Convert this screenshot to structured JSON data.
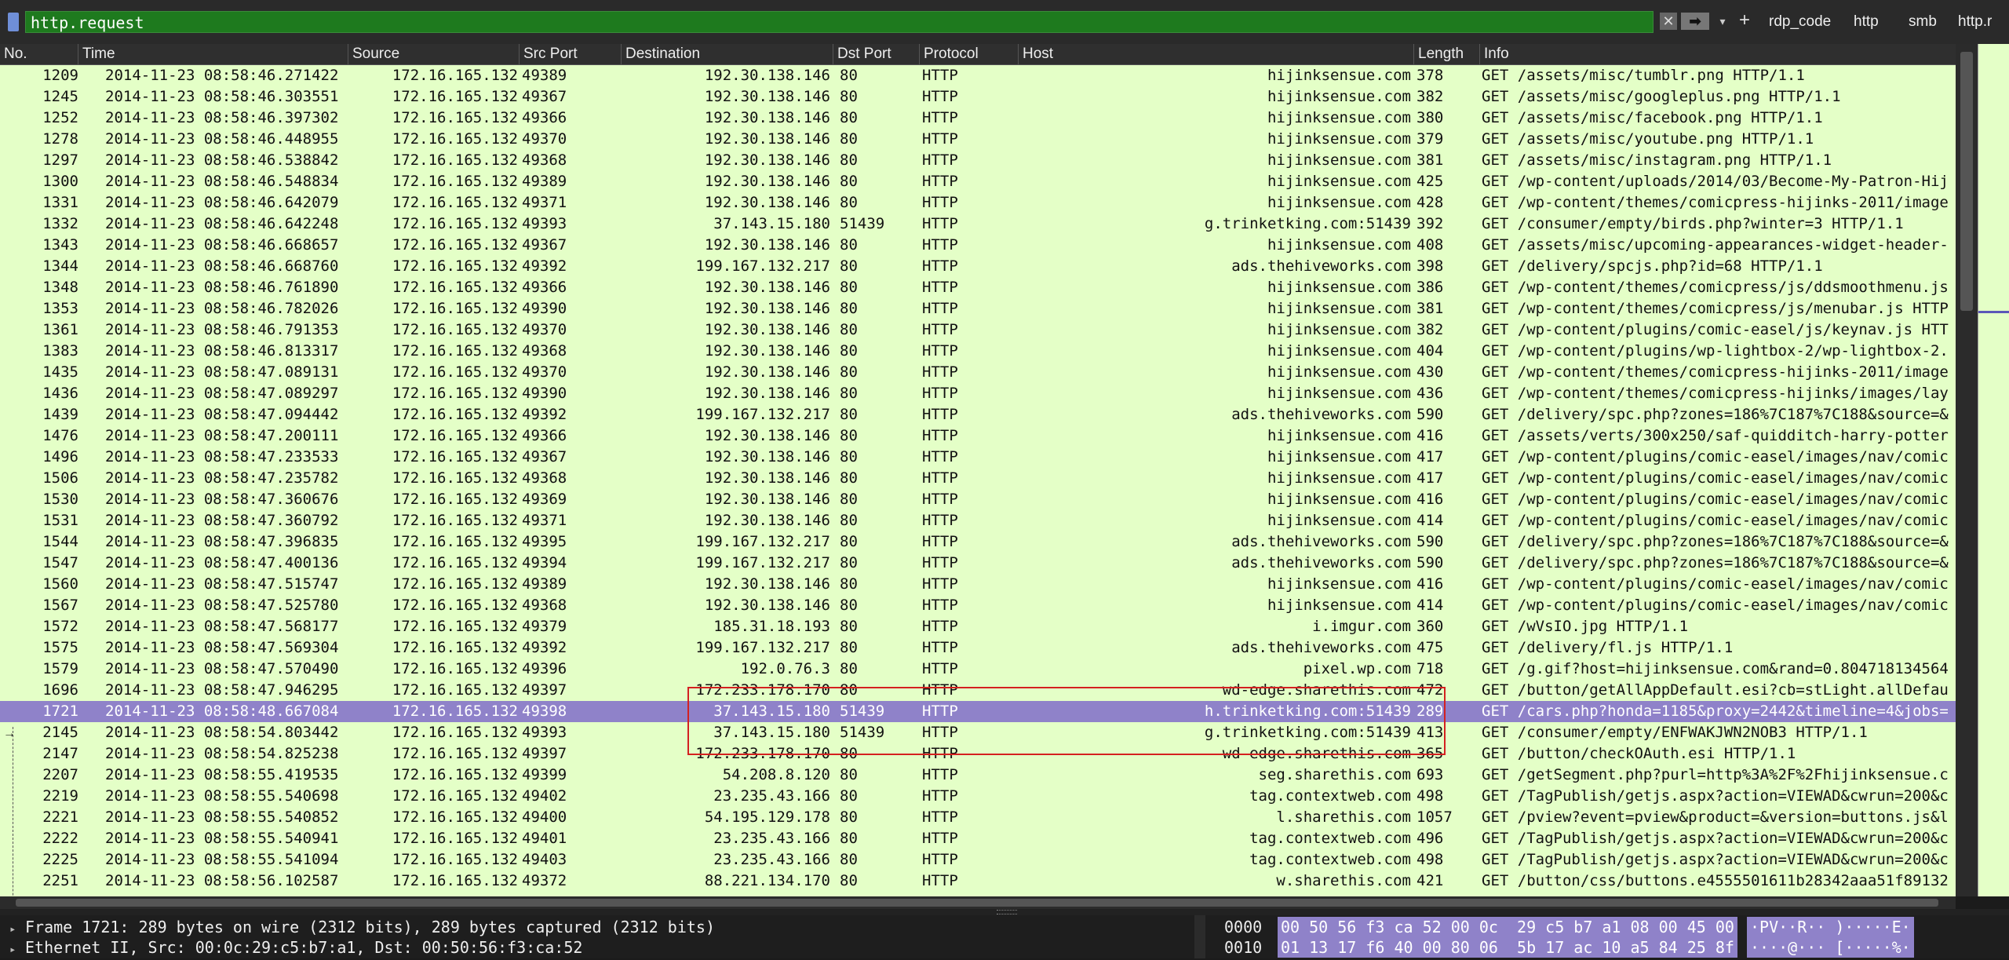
{
  "filter": {
    "value": "http.request",
    "clear_icon": "✕",
    "apply_icon": "➡",
    "dropdown_icon": "▾",
    "add_icon": "+",
    "quick_buttons": [
      "rdp_code",
      "http",
      "smb",
      "http.r"
    ]
  },
  "columns": [
    "No.",
    "Time",
    "Source",
    "Src Port",
    "Destination",
    "Dst Port",
    "Protocol",
    "Host",
    "Length",
    "Info"
  ],
  "selected_frame": "1721",
  "rows": [
    {
      "no": "1209",
      "time": "2014-11-23 08:58:46.271422",
      "src": "172.16.165.132",
      "sport": "49389",
      "dst": "192.30.138.146",
      "dport": "80",
      "proto": "HTTP",
      "host": "hijinksensue.com",
      "len": "378",
      "info": "GET /assets/misc/tumblr.png HTTP/1.1"
    },
    {
      "no": "1245",
      "time": "2014-11-23 08:58:46.303551",
      "src": "172.16.165.132",
      "sport": "49367",
      "dst": "192.30.138.146",
      "dport": "80",
      "proto": "HTTP",
      "host": "hijinksensue.com",
      "len": "382",
      "info": "GET /assets/misc/googleplus.png HTTP/1.1"
    },
    {
      "no": "1252",
      "time": "2014-11-23 08:58:46.397302",
      "src": "172.16.165.132",
      "sport": "49366",
      "dst": "192.30.138.146",
      "dport": "80",
      "proto": "HTTP",
      "host": "hijinksensue.com",
      "len": "380",
      "info": "GET /assets/misc/facebook.png HTTP/1.1"
    },
    {
      "no": "1278",
      "time": "2014-11-23 08:58:46.448955",
      "src": "172.16.165.132",
      "sport": "49370",
      "dst": "192.30.138.146",
      "dport": "80",
      "proto": "HTTP",
      "host": "hijinksensue.com",
      "len": "379",
      "info": "GET /assets/misc/youtube.png HTTP/1.1"
    },
    {
      "no": "1297",
      "time": "2014-11-23 08:58:46.538842",
      "src": "172.16.165.132",
      "sport": "49368",
      "dst": "192.30.138.146",
      "dport": "80",
      "proto": "HTTP",
      "host": "hijinksensue.com",
      "len": "381",
      "info": "GET /assets/misc/instagram.png HTTP/1.1"
    },
    {
      "no": "1300",
      "time": "2014-11-23 08:58:46.548834",
      "src": "172.16.165.132",
      "sport": "49389",
      "dst": "192.30.138.146",
      "dport": "80",
      "proto": "HTTP",
      "host": "hijinksensue.com",
      "len": "425",
      "info": "GET /wp-content/uploads/2014/03/Become-My-Patron-Hij"
    },
    {
      "no": "1331",
      "time": "2014-11-23 08:58:46.642079",
      "src": "172.16.165.132",
      "sport": "49371",
      "dst": "192.30.138.146",
      "dport": "80",
      "proto": "HTTP",
      "host": "hijinksensue.com",
      "len": "428",
      "info": "GET /wp-content/themes/comicpress-hijinks-2011/image"
    },
    {
      "no": "1332",
      "time": "2014-11-23 08:58:46.642248",
      "src": "172.16.165.132",
      "sport": "49393",
      "dst": "37.143.15.180",
      "dport": "51439",
      "proto": "HTTP",
      "host": "g.trinketking.com:51439",
      "len": "392",
      "info": "GET /consumer/empty/birds.php?winter=3 HTTP/1.1"
    },
    {
      "no": "1343",
      "time": "2014-11-23 08:58:46.668657",
      "src": "172.16.165.132",
      "sport": "49367",
      "dst": "192.30.138.146",
      "dport": "80",
      "proto": "HTTP",
      "host": "hijinksensue.com",
      "len": "408",
      "info": "GET /assets/misc/upcoming-appearances-widget-header-"
    },
    {
      "no": "1344",
      "time": "2014-11-23 08:58:46.668760",
      "src": "172.16.165.132",
      "sport": "49392",
      "dst": "199.167.132.217",
      "dport": "80",
      "proto": "HTTP",
      "host": "ads.thehiveworks.com",
      "len": "398",
      "info": "GET /delivery/spcjs.php?id=68 HTTP/1.1"
    },
    {
      "no": "1348",
      "time": "2014-11-23 08:58:46.761890",
      "src": "172.16.165.132",
      "sport": "49366",
      "dst": "192.30.138.146",
      "dport": "80",
      "proto": "HTTP",
      "host": "hijinksensue.com",
      "len": "386",
      "info": "GET /wp-content/themes/comicpress/js/ddsmoothmenu.js"
    },
    {
      "no": "1353",
      "time": "2014-11-23 08:58:46.782026",
      "src": "172.16.165.132",
      "sport": "49390",
      "dst": "192.30.138.146",
      "dport": "80",
      "proto": "HTTP",
      "host": "hijinksensue.com",
      "len": "381",
      "info": "GET /wp-content/themes/comicpress/js/menubar.js HTTP"
    },
    {
      "no": "1361",
      "time": "2014-11-23 08:58:46.791353",
      "src": "172.16.165.132",
      "sport": "49370",
      "dst": "192.30.138.146",
      "dport": "80",
      "proto": "HTTP",
      "host": "hijinksensue.com",
      "len": "382",
      "info": "GET /wp-content/plugins/comic-easel/js/keynav.js HTT"
    },
    {
      "no": "1383",
      "time": "2014-11-23 08:58:46.813317",
      "src": "172.16.165.132",
      "sport": "49368",
      "dst": "192.30.138.146",
      "dport": "80",
      "proto": "HTTP",
      "host": "hijinksensue.com",
      "len": "404",
      "info": "GET /wp-content/plugins/wp-lightbox-2/wp-lightbox-2."
    },
    {
      "no": "1435",
      "time": "2014-11-23 08:58:47.089131",
      "src": "172.16.165.132",
      "sport": "49370",
      "dst": "192.30.138.146",
      "dport": "80",
      "proto": "HTTP",
      "host": "hijinksensue.com",
      "len": "430",
      "info": "GET /wp-content/themes/comicpress-hijinks-2011/image"
    },
    {
      "no": "1436",
      "time": "2014-11-23 08:58:47.089297",
      "src": "172.16.165.132",
      "sport": "49390",
      "dst": "192.30.138.146",
      "dport": "80",
      "proto": "HTTP",
      "host": "hijinksensue.com",
      "len": "436",
      "info": "GET /wp-content/themes/comicpress-hijinks/images/lay"
    },
    {
      "no": "1439",
      "time": "2014-11-23 08:58:47.094442",
      "src": "172.16.165.132",
      "sport": "49392",
      "dst": "199.167.132.217",
      "dport": "80",
      "proto": "HTTP",
      "host": "ads.thehiveworks.com",
      "len": "590",
      "info": "GET /delivery/spc.php?zones=186%7C187%7C188&source=&"
    },
    {
      "no": "1476",
      "time": "2014-11-23 08:58:47.200111",
      "src": "172.16.165.132",
      "sport": "49366",
      "dst": "192.30.138.146",
      "dport": "80",
      "proto": "HTTP",
      "host": "hijinksensue.com",
      "len": "416",
      "info": "GET /assets/verts/300x250/saf-quidditch-harry-potter"
    },
    {
      "no": "1496",
      "time": "2014-11-23 08:58:47.233533",
      "src": "172.16.165.132",
      "sport": "49367",
      "dst": "192.30.138.146",
      "dport": "80",
      "proto": "HTTP",
      "host": "hijinksensue.com",
      "len": "417",
      "info": "GET /wp-content/plugins/comic-easel/images/nav/comic"
    },
    {
      "no": "1506",
      "time": "2014-11-23 08:58:47.235782",
      "src": "172.16.165.132",
      "sport": "49368",
      "dst": "192.30.138.146",
      "dport": "80",
      "proto": "HTTP",
      "host": "hijinksensue.com",
      "len": "417",
      "info": "GET /wp-content/plugins/comic-easel/images/nav/comic"
    },
    {
      "no": "1530",
      "time": "2014-11-23 08:58:47.360676",
      "src": "172.16.165.132",
      "sport": "49369",
      "dst": "192.30.138.146",
      "dport": "80",
      "proto": "HTTP",
      "host": "hijinksensue.com",
      "len": "416",
      "info": "GET /wp-content/plugins/comic-easel/images/nav/comic"
    },
    {
      "no": "1531",
      "time": "2014-11-23 08:58:47.360792",
      "src": "172.16.165.132",
      "sport": "49371",
      "dst": "192.30.138.146",
      "dport": "80",
      "proto": "HTTP",
      "host": "hijinksensue.com",
      "len": "414",
      "info": "GET /wp-content/plugins/comic-easel/images/nav/comic"
    },
    {
      "no": "1544",
      "time": "2014-11-23 08:58:47.396835",
      "src": "172.16.165.132",
      "sport": "49395",
      "dst": "199.167.132.217",
      "dport": "80",
      "proto": "HTTP",
      "host": "ads.thehiveworks.com",
      "len": "590",
      "info": "GET /delivery/spc.php?zones=186%7C187%7C188&source=&"
    },
    {
      "no": "1547",
      "time": "2014-11-23 08:58:47.400136",
      "src": "172.16.165.132",
      "sport": "49394",
      "dst": "199.167.132.217",
      "dport": "80",
      "proto": "HTTP",
      "host": "ads.thehiveworks.com",
      "len": "590",
      "info": "GET /delivery/spc.php?zones=186%7C187%7C188&source=&"
    },
    {
      "no": "1560",
      "time": "2014-11-23 08:58:47.515747",
      "src": "172.16.165.132",
      "sport": "49389",
      "dst": "192.30.138.146",
      "dport": "80",
      "proto": "HTTP",
      "host": "hijinksensue.com",
      "len": "416",
      "info": "GET /wp-content/plugins/comic-easel/images/nav/comic"
    },
    {
      "no": "1567",
      "time": "2014-11-23 08:58:47.525780",
      "src": "172.16.165.132",
      "sport": "49368",
      "dst": "192.30.138.146",
      "dport": "80",
      "proto": "HTTP",
      "host": "hijinksensue.com",
      "len": "414",
      "info": "GET /wp-content/plugins/comic-easel/images/nav/comic"
    },
    {
      "no": "1572",
      "time": "2014-11-23 08:58:47.568177",
      "src": "172.16.165.132",
      "sport": "49379",
      "dst": "185.31.18.193",
      "dport": "80",
      "proto": "HTTP",
      "host": "i.imgur.com",
      "len": "360",
      "info": "GET /wVsIO.jpg HTTP/1.1"
    },
    {
      "no": "1575",
      "time": "2014-11-23 08:58:47.569304",
      "src": "172.16.165.132",
      "sport": "49392",
      "dst": "199.167.132.217",
      "dport": "80",
      "proto": "HTTP",
      "host": "ads.thehiveworks.com",
      "len": "475",
      "info": "GET /delivery/fl.js HTTP/1.1"
    },
    {
      "no": "1579",
      "time": "2014-11-23 08:58:47.570490",
      "src": "172.16.165.132",
      "sport": "49396",
      "dst": "192.0.76.3",
      "dport": "80",
      "proto": "HTTP",
      "host": "pixel.wp.com",
      "len": "718",
      "info": "GET /g.gif?host=hijinksensue.com&rand=0.804718134564"
    },
    {
      "no": "1696",
      "time": "2014-11-23 08:58:47.946295",
      "src": "172.16.165.132",
      "sport": "49397",
      "dst": "172.233.178.170",
      "dport": "80",
      "proto": "HTTP",
      "host": "wd-edge.sharethis.com",
      "len": "472",
      "info": "GET /button/getAllAppDefault.esi?cb=stLight.allDefau"
    },
    {
      "no": "1721",
      "time": "2014-11-23 08:58:48.667084",
      "src": "172.16.165.132",
      "sport": "49398",
      "dst": "37.143.15.180",
      "dport": "51439",
      "proto": "HTTP",
      "host": "h.trinketking.com:51439",
      "len": "289",
      "info": "GET /cars.php?honda=1185&proxy=2442&timeline=4&jobs="
    },
    {
      "no": "2145",
      "time": "2014-11-23 08:58:54.803442",
      "src": "172.16.165.132",
      "sport": "49393",
      "dst": "37.143.15.180",
      "dport": "51439",
      "proto": "HTTP",
      "host": "g.trinketking.com:51439",
      "len": "413",
      "info": "GET /consumer/empty/ENFWAKJWN2NOB3 HTTP/1.1"
    },
    {
      "no": "2147",
      "time": "2014-11-23 08:58:54.825238",
      "src": "172.16.165.132",
      "sport": "49397",
      "dst": "172.233.178.170",
      "dport": "80",
      "proto": "HTTP",
      "host": "wd-edge.sharethis.com",
      "len": "365",
      "info": "GET /button/checkOAuth.esi HTTP/1.1"
    },
    {
      "no": "2207",
      "time": "2014-11-23 08:58:55.419535",
      "src": "172.16.165.132",
      "sport": "49399",
      "dst": "54.208.8.120",
      "dport": "80",
      "proto": "HTTP",
      "host": "seg.sharethis.com",
      "len": "693",
      "info": "GET /getSegment.php?purl=http%3A%2F%2Fhijinksensue.c"
    },
    {
      "no": "2219",
      "time": "2014-11-23 08:58:55.540698",
      "src": "172.16.165.132",
      "sport": "49402",
      "dst": "23.235.43.166",
      "dport": "80",
      "proto": "HTTP",
      "host": "tag.contextweb.com",
      "len": "498",
      "info": "GET /TagPublish/getjs.aspx?action=VIEWAD&cwrun=200&c"
    },
    {
      "no": "2221",
      "time": "2014-11-23 08:58:55.540852",
      "src": "172.16.165.132",
      "sport": "49400",
      "dst": "54.195.129.178",
      "dport": "80",
      "proto": "HTTP",
      "host": "l.sharethis.com",
      "len": "1057",
      "info": "GET /pview?event=pview&product=&version=buttons.js&l"
    },
    {
      "no": "2222",
      "time": "2014-11-23 08:58:55.540941",
      "src": "172.16.165.132",
      "sport": "49401",
      "dst": "23.235.43.166",
      "dport": "80",
      "proto": "HTTP",
      "host": "tag.contextweb.com",
      "len": "496",
      "info": "GET /TagPublish/getjs.aspx?action=VIEWAD&cwrun=200&c"
    },
    {
      "no": "2225",
      "time": "2014-11-23 08:58:55.541094",
      "src": "172.16.165.132",
      "sport": "49403",
      "dst": "23.235.43.166",
      "dport": "80",
      "proto": "HTTP",
      "host": "tag.contextweb.com",
      "len": "498",
      "info": "GET /TagPublish/getjs.aspx?action=VIEWAD&cwrun=200&c"
    },
    {
      "no": "2251",
      "time": "2014-11-23 08:58:56.102587",
      "src": "172.16.165.132",
      "sport": "49372",
      "dst": "88.221.134.170",
      "dport": "80",
      "proto": "HTTP",
      "host": "w.sharethis.com",
      "len": "421",
      "info": "GET /button/css/buttons.e4555501611b28342aaa51f89132"
    }
  ],
  "detail": {
    "expand_icon": "▸",
    "frame_line": "Frame 1721: 289 bytes on wire (2312 bits), 289 bytes captured (2312 bits)",
    "ethernet_line": "Ethernet II, Src: 00:0c:29:c5:b7:a1, Dst: 00:50:56:f3:ca:52"
  },
  "bytes": {
    "rows": [
      {
        "offset": "0000",
        "hex": "00 50 56 f3 ca 52 00 0c  29 c5 b7 a1 08 00 45 00",
        "ascii": "·PV··R·· )·····E·"
      },
      {
        "offset": "0010",
        "hex": "01 13 17 f6 40 00 80 06  5b 17 ac 10 a5 84 25 8f",
        "ascii": "····@··· [·····%·"
      }
    ]
  },
  "colors": {
    "filter_ok": "#1e7a1e",
    "row_bg": "#e4ffc7",
    "selected_row": "#8f82c9",
    "annotation_box": "#d42020"
  }
}
